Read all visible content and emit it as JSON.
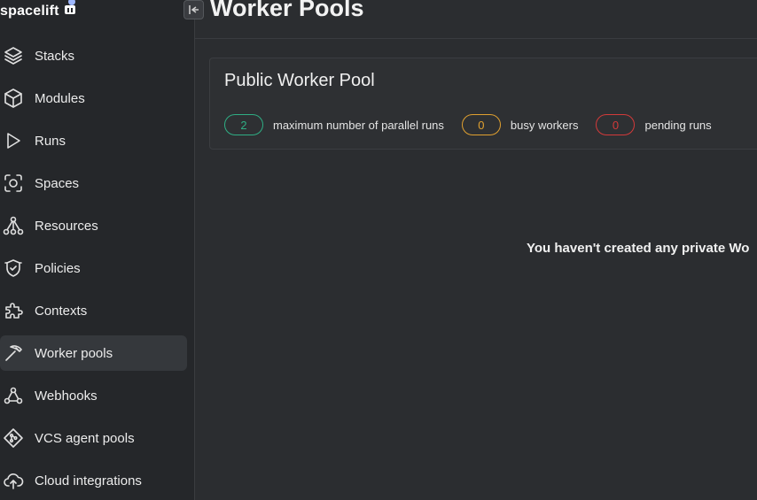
{
  "app": {
    "logo_text": "spacelift"
  },
  "sidebar": {
    "items": [
      {
        "label": "Stacks",
        "icon": "layers-icon"
      },
      {
        "label": "Modules",
        "icon": "cube-icon"
      },
      {
        "label": "Runs",
        "icon": "play-icon"
      },
      {
        "label": "Spaces",
        "icon": "spaces-icon"
      },
      {
        "label": "Resources",
        "icon": "resources-icon"
      },
      {
        "label": "Policies",
        "icon": "shield-icon"
      },
      {
        "label": "Contexts",
        "icon": "puzzle-icon"
      },
      {
        "label": "Worker pools",
        "icon": "pickaxe-icon",
        "active": true
      },
      {
        "label": "Webhooks",
        "icon": "webhook-icon"
      },
      {
        "label": "VCS agent pools",
        "icon": "git-icon"
      },
      {
        "label": "Cloud integrations",
        "icon": "cloud-icon"
      }
    ]
  },
  "header": {
    "title": "Worker Pools"
  },
  "public_pool": {
    "title": "Public Worker Pool",
    "max_parallel_runs": "2",
    "max_parallel_runs_label": "maximum number of parallel runs",
    "busy_workers": "0",
    "busy_workers_label": "busy workers",
    "pending_runs": "0",
    "pending_runs_label": "pending runs"
  },
  "empty_state": {
    "message": "You haven't created any private Wo"
  },
  "colors": {
    "accent_green": "#2fae84",
    "accent_amber": "#e0a030",
    "accent_red": "#d33a3a",
    "background": "#2b2d30",
    "sidebar": "#25272a"
  }
}
